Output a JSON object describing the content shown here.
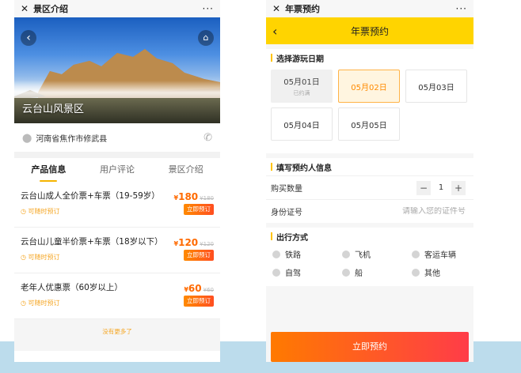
{
  "left": {
    "window_title": "景区介绍",
    "close_glyph": "✕",
    "more_glyph": "···",
    "scenic_name": "云台山风景区",
    "address": "河南省焦作市修武县",
    "tabs": [
      {
        "label": "产品信息",
        "active": true
      },
      {
        "label": "用户评论",
        "active": false
      },
      {
        "label": "景区介绍",
        "active": false
      }
    ],
    "tickets": [
      {
        "name": "云台山成人全价票+车票（19-59岁）",
        "note": "可随时预订",
        "currency": "¥",
        "price": "180",
        "original_price": "¥180",
        "button": "立即预订"
      },
      {
        "name": "云台山儿童半价票+车票（18岁以下）",
        "note": "可随时预订",
        "currency": "¥",
        "price": "120",
        "original_price": "¥120",
        "button": "立即预订"
      },
      {
        "name": "老年人优惠票（60岁以上）",
        "note": "可随时预订",
        "currency": "¥",
        "price": "60",
        "original_price": "¥60",
        "button": "立即预订"
      }
    ],
    "no_more": "没有更多了"
  },
  "right": {
    "window_title": "年票预约",
    "close_glyph": "✕",
    "more_glyph": "···",
    "nav_title": "年票预约",
    "date_section_title": "选择游玩日期",
    "dates": [
      {
        "label": "05月01日",
        "sub": "已约满",
        "state": "full"
      },
      {
        "label": "05月02日",
        "sub": "",
        "state": "selected"
      },
      {
        "label": "05月03日",
        "sub": "",
        "state": "normal"
      },
      {
        "label": "05月04日",
        "sub": "",
        "state": "normal"
      },
      {
        "label": "05月05日",
        "sub": "",
        "state": "normal"
      }
    ],
    "info_section_title": "填写预约人信息",
    "quantity_label": "购买数量",
    "quantity_value": "1",
    "minus_glyph": "−",
    "plus_glyph": "+",
    "id_label": "身份证号",
    "id_placeholder": "请输入您的证件号",
    "travel_section_title": "出行方式",
    "travel_options": [
      "铁路",
      "飞机",
      "客运车辆",
      "自驾",
      "船",
      "其他"
    ],
    "submit_label": "立即预约"
  },
  "colors": {
    "accent_yellow": "#ffd400",
    "price_orange": "#ff6a00",
    "button_gradient_start": "#ff7a00",
    "button_gradient_end": "#ff3c48",
    "bottom_band": "#bcdcec"
  },
  "icons": {
    "back": "chevron-left-icon",
    "home": "home-icon",
    "location": "location-pin-icon",
    "phone": "phone-icon",
    "clock": "clock-icon",
    "radio": "radio-circle-icon"
  }
}
